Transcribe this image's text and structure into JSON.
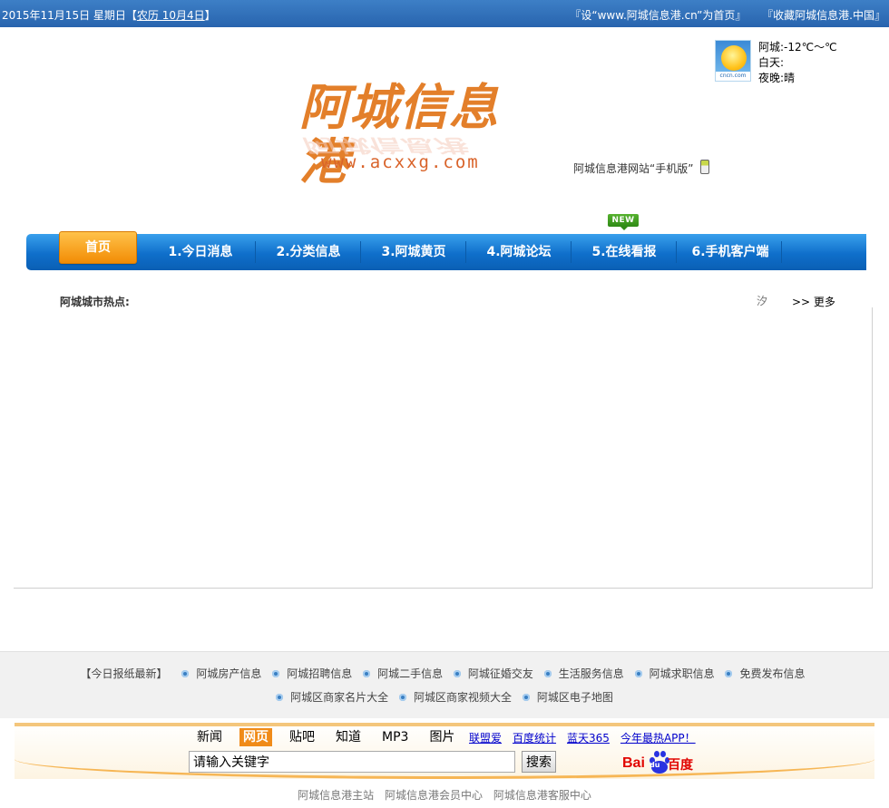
{
  "topbar": {
    "date": "2015年11月15日 星期日",
    "lunar_open": "【",
    "lunar_link": "农历  10月4日",
    "lunar_close": "】",
    "set_home": "『设“www.阿城信息港.cn”为首页』",
    "bookmark": "『收藏阿城信息港.中国』"
  },
  "logo": {
    "title": "阿城信息港",
    "url": "www.acxxg.com"
  },
  "weather": {
    "icon": "sunny-icon",
    "icon_tag": "cncn.com",
    "city": "阿城:-12℃～℃",
    "day": "白天:",
    "night": "夜晚:晴"
  },
  "mobile": {
    "text": "阿城信息港网站“手机版”",
    "icon": "mobile-phone-icon"
  },
  "nav": {
    "home": "首页",
    "items": [
      "1.今日消息",
      "2.分类信息",
      "3.阿城黄页",
      "4.阿城论坛",
      "5.在线看报",
      "6.手机客户端"
    ],
    "new_badge": "NEW"
  },
  "hot": {
    "label": "阿城城市热点:",
    "glyph": "汐",
    "more": ">> 更多"
  },
  "links": {
    "newspaper": "【今日报纸最新】",
    "row1": [
      "阿城房产信息",
      "阿城招聘信息",
      "阿城二手信息",
      "阿城征婚交友",
      "生活服务信息",
      "阿城求职信息",
      "免费发布信息"
    ],
    "row2": [
      "阿城区商家名片大全",
      "阿城区商家视频大全",
      "阿城区电子地图"
    ]
  },
  "baidu": {
    "tabs": [
      "新闻",
      "网页",
      "贴吧",
      "知道",
      "MP3",
      "图片"
    ],
    "active_tab": "网页",
    "extra": [
      "联盟爱",
      "百度统计",
      "蓝天365",
      "今年最热APP！"
    ],
    "input_value": "请输入关键字",
    "button": "搜索",
    "logo_bai": "Bai",
    "logo_du": "du",
    "logo_cn": "百度"
  },
  "bottom": [
    "阿城信息港主站",
    "阿城信息港会员中心",
    "阿城信息港客服中心"
  ],
  "colors": {
    "topbar": "#2864ae",
    "nav": "#0f6fcb",
    "home_tab": "#f28c05",
    "logo": "#e37f2a"
  }
}
